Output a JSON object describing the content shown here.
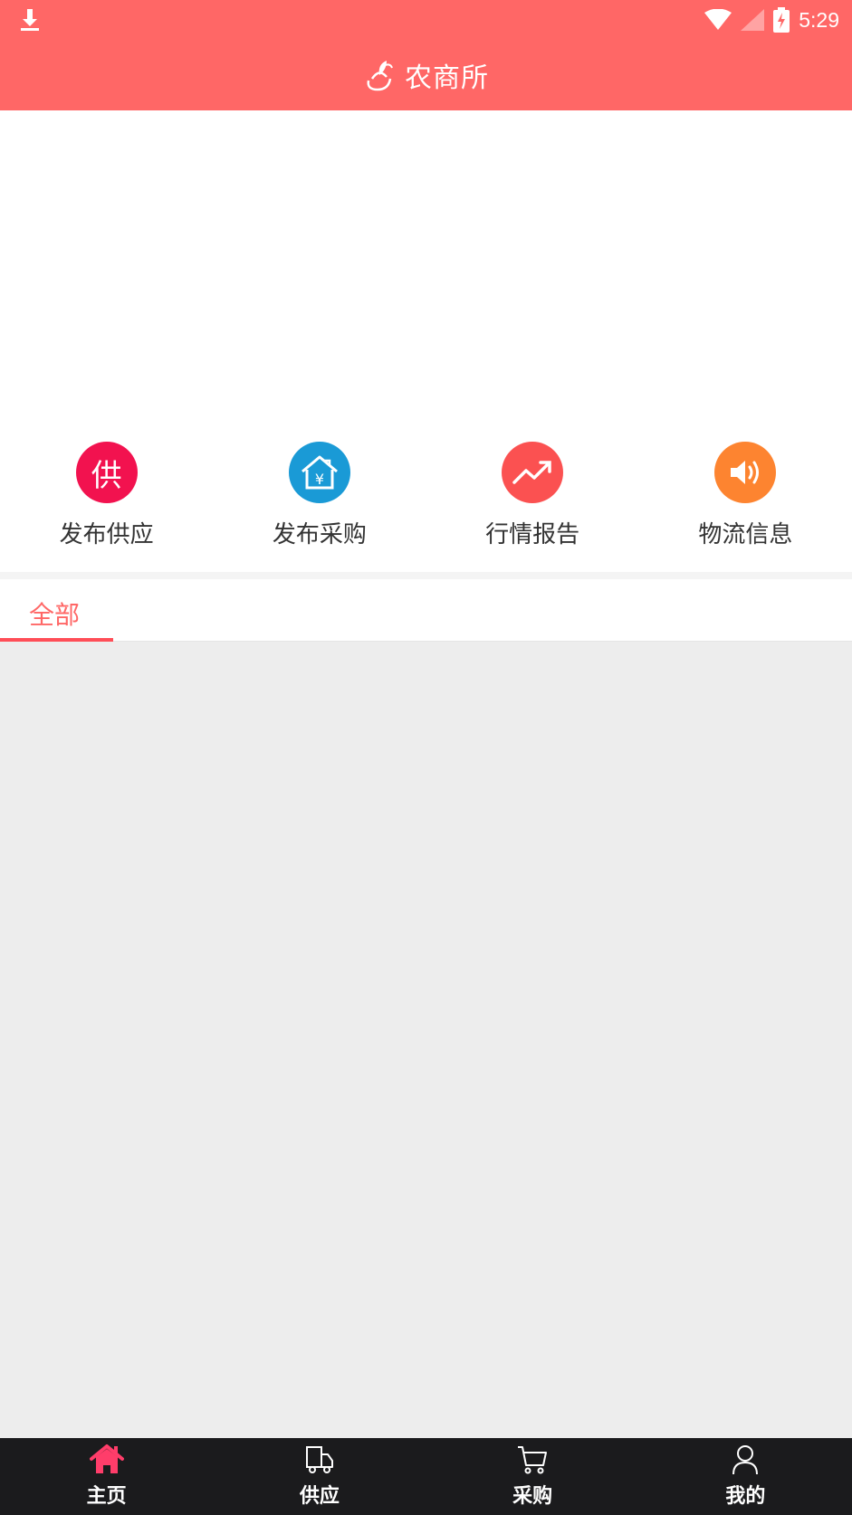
{
  "status_bar": {
    "time": "5:29",
    "icons": [
      "download-icon",
      "wifi-icon",
      "signal-icon",
      "battery-charging-icon"
    ]
  },
  "header": {
    "title": "农商所",
    "logo_icon": "hand-leaf-logo"
  },
  "colors": {
    "brand": "#ff6766",
    "tab_active": "#ff6766",
    "nav_active": "#ff3d6a",
    "nav_bg": "#1b1b1d"
  },
  "shortcuts": [
    {
      "label": "发布供应",
      "icon": "supply-icon",
      "icon_text": "供",
      "color": "#f2124f"
    },
    {
      "label": "发布采购",
      "icon": "purchase-house-yen-icon",
      "color": "#1a9ad6"
    },
    {
      "label": "行情报告",
      "icon": "trend-up-icon",
      "color": "#fb5151"
    },
    {
      "label": "物流信息",
      "icon": "speaker-icon",
      "color": "#fd8430"
    }
  ],
  "tabs": [
    {
      "label": "全部",
      "active": true
    }
  ],
  "bottom_nav": [
    {
      "label": "主页",
      "icon": "home-icon",
      "active": true
    },
    {
      "label": "供应",
      "icon": "truck-icon",
      "active": false
    },
    {
      "label": "采购",
      "icon": "cart-icon",
      "active": false
    },
    {
      "label": "我的",
      "icon": "person-icon",
      "active": false
    }
  ]
}
